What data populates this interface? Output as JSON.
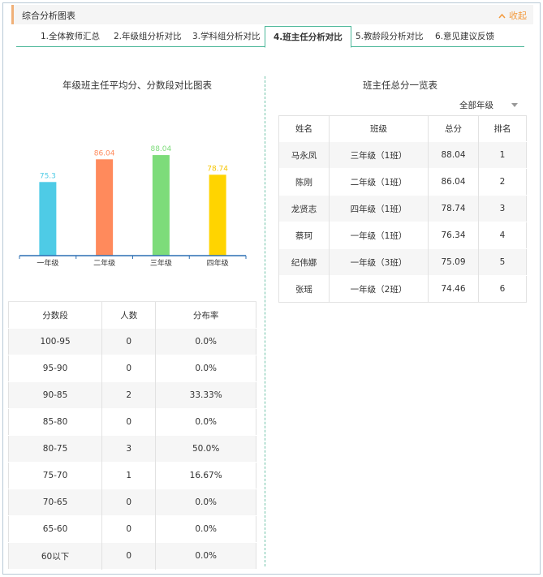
{
  "header": {
    "title": "综合分析图表",
    "collapse_label": "收起"
  },
  "tabs": [
    {
      "label": "1.全体教师汇总",
      "active": false
    },
    {
      "label": "2.年级组分析对比",
      "active": false
    },
    {
      "label": "3.学科组分析对比",
      "active": false
    },
    {
      "label": "4.班主任分析对比",
      "active": true
    },
    {
      "label": "5.教龄段分析对比",
      "active": false
    },
    {
      "label": "6.意见建议反馈",
      "active": false
    }
  ],
  "left": {
    "chart_title": "年级班主任平均分、分数段对比图表"
  },
  "chart_data": {
    "type": "bar",
    "title": "年级班主任平均分、分数段对比图表",
    "categories": [
      "一年级",
      "二年级",
      "三年级",
      "四年级"
    ],
    "values": [
      75.3,
      86.04,
      88.04,
      78.74
    ],
    "value_labels": [
      "75.3",
      "86.04",
      "88.04",
      "78.74"
    ],
    "colors": [
      "#4ecbe6",
      "#ff8a5c",
      "#7ddc7a",
      "#ffd400"
    ],
    "label_colors": [
      "#4ecbe6",
      "#ff8a5c",
      "#7ddc7a",
      "#f5c400"
    ],
    "ylim": [
      0,
      100
    ],
    "grid": false,
    "xlabel": "",
    "ylabel": ""
  },
  "score_table": {
    "headers": [
      "分数段",
      "人数",
      "分布率"
    ],
    "rows": [
      [
        "100-95",
        "0",
        "0.0%"
      ],
      [
        "95-90",
        "0",
        "0.0%"
      ],
      [
        "90-85",
        "2",
        "33.33%"
      ],
      [
        "85-80",
        "0",
        "0.0%"
      ],
      [
        "80-75",
        "3",
        "50.0%"
      ],
      [
        "75-70",
        "1",
        "16.67%"
      ],
      [
        "70-65",
        "0",
        "0.0%"
      ],
      [
        "65-60",
        "0",
        "0.0%"
      ],
      [
        "60以下",
        "0",
        "0.0%"
      ]
    ]
  },
  "right": {
    "title": "班主任总分一览表",
    "grade_select": {
      "selected": "全部年级"
    }
  },
  "rank_table": {
    "headers": [
      "姓名",
      "班级",
      "总分",
      "排名"
    ],
    "rows": [
      [
        "马永凤",
        "三年级（1班）",
        "88.04",
        "1"
      ],
      [
        "陈刚",
        "二年级（1班）",
        "86.04",
        "2"
      ],
      [
        "龙贤志",
        "四年级（1班）",
        "78.74",
        "3"
      ],
      [
        "蔡珂",
        "一年级（1班）",
        "76.34",
        "4"
      ],
      [
        "纪伟娜",
        "一年级（3班）",
        "75.09",
        "5"
      ],
      [
        "张瑶",
        "一年级（2班）",
        "74.46",
        "6"
      ]
    ]
  }
}
